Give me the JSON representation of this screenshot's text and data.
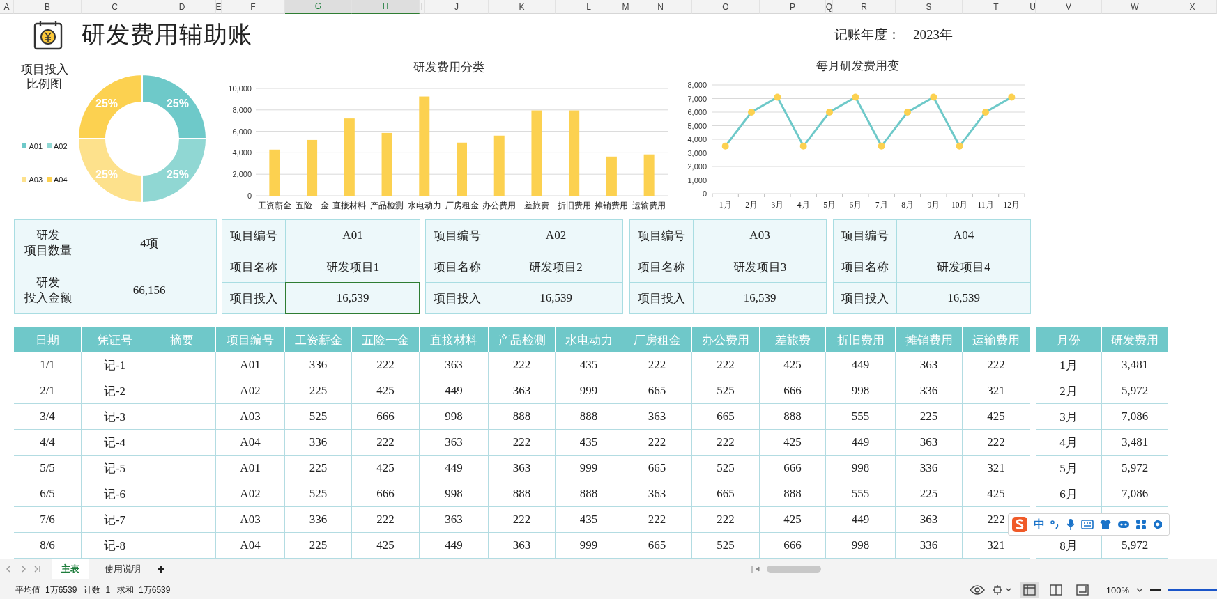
{
  "columns": [
    {
      "label": "A",
      "selected": false
    },
    {
      "label": "B",
      "selected": false
    },
    {
      "label": "C",
      "selected": false
    },
    {
      "label": "D",
      "selected": false
    },
    {
      "label": "E",
      "selected": false
    },
    {
      "label": "F",
      "selected": false
    },
    {
      "label": "G",
      "selected": true
    },
    {
      "label": "H",
      "selected": true
    },
    {
      "label": "I",
      "selected": false
    },
    {
      "label": "J",
      "selected": false
    },
    {
      "label": "K",
      "selected": false
    },
    {
      "label": "L",
      "selected": false
    },
    {
      "label": "M",
      "selected": false
    },
    {
      "label": "N",
      "selected": false
    },
    {
      "label": "O",
      "selected": false
    },
    {
      "label": "P",
      "selected": false
    },
    {
      "label": "Q",
      "selected": false
    },
    {
      "label": "R",
      "selected": false
    },
    {
      "label": "S",
      "selected": false
    },
    {
      "label": "T",
      "selected": false
    },
    {
      "label": "U",
      "selected": false
    },
    {
      "label": "V",
      "selected": false
    },
    {
      "label": "W",
      "selected": false
    },
    {
      "label": "X",
      "selected": false
    }
  ],
  "title": "研发费用辅助账",
  "year": {
    "label": "记账年度：",
    "value": "2023年"
  },
  "pie_chart": {
    "chart_data": {
      "type": "donut",
      "title": "项目投入比例图",
      "categories": [
        "A01",
        "A02",
        "A03",
        "A04"
      ],
      "values": [
        25,
        25,
        25,
        25
      ],
      "colors": [
        "#6ec9c9",
        "#90d7d3",
        "#fde18c",
        "#fcd150"
      ],
      "value_labels": [
        "25%",
        "25%",
        "25%",
        "25%"
      ],
      "legend": "left"
    }
  },
  "category_chart": {
    "chart_data": {
      "type": "bar",
      "title": "研发费用分类",
      "categories": [
        "工资薪金",
        "五险一金",
        "直接材料",
        "产品检测",
        "水电动力",
        "厂房租金",
        "办公费用",
        "差旅费",
        "折旧费用",
        "摊销费用",
        "运输费用"
      ],
      "series": [
        {
          "color": "#fcd150",
          "values": [
            4300,
            5200,
            7200,
            5850,
            9250,
            4950,
            5600,
            7950,
            7950,
            3650,
            3850
          ]
        }
      ],
      "grid": true,
      "ylim": [
        0,
        10000
      ],
      "yticks": [
        {
          "value": 0,
          "label": "0"
        },
        {
          "value": 2000,
          "label": "2,000"
        },
        {
          "value": 4000,
          "label": "4,000"
        },
        {
          "value": 6000,
          "label": "6,000"
        },
        {
          "value": 8000,
          "label": "8,000"
        },
        {
          "value": 10000,
          "label": "10,000"
        }
      ]
    }
  },
  "monthly_chart": {
    "chart_data": {
      "type": "line",
      "title": "每月研发费用变",
      "categories": [
        "1月",
        "2月",
        "3月",
        "4月",
        "5月",
        "6月",
        "7月",
        "8月",
        "9月",
        "10月",
        "11月",
        "12月"
      ],
      "series": [
        {
          "color": "#6ec9c9",
          "marker": {
            "shape": "circle",
            "color": "#fcd150"
          },
          "values": [
            3500,
            6000,
            7100,
            3500,
            6000,
            7100,
            3500,
            6000,
            7100,
            3500,
            6000,
            7100
          ]
        }
      ],
      "grid": true,
      "ylim": [
        0,
        8000
      ],
      "yticks": [
        {
          "value": 0,
          "label": "0"
        },
        {
          "value": 1000,
          "label": "1,000"
        },
        {
          "value": 2000,
          "label": "2,000"
        },
        {
          "value": 3000,
          "label": "3,000"
        },
        {
          "value": 4000,
          "label": "4,000"
        },
        {
          "value": 5000,
          "label": "5,000"
        },
        {
          "value": 6000,
          "label": "6,000"
        },
        {
          "value": 7000,
          "label": "7,000"
        },
        {
          "value": 8000,
          "label": "8,000"
        }
      ]
    }
  },
  "summary_card": [
    {
      "label_lines": [
        "研发",
        "项目数量"
      ],
      "value": "4项"
    },
    {
      "label_lines": [
        "研发",
        "投入金额"
      ],
      "value": "66,156"
    }
  ],
  "project_cards": [
    {
      "fields": [
        {
          "label": "项目编号",
          "value": "A01",
          "selected": false
        },
        {
          "label": "项目名称",
          "value": "研发项目1",
          "selected": false
        },
        {
          "label": "项目投入",
          "value": "16,539",
          "selected": true
        }
      ]
    },
    {
      "fields": [
        {
          "label": "项目编号",
          "value": "A02",
          "selected": false
        },
        {
          "label": "项目名称",
          "value": "研发项目2",
          "selected": false
        },
        {
          "label": "项目投入",
          "value": "16,539",
          "selected": false
        }
      ]
    },
    {
      "fields": [
        {
          "label": "项目编号",
          "value": "A03",
          "selected": false
        },
        {
          "label": "项目名称",
          "value": "研发项目3",
          "selected": false
        },
        {
          "label": "项目投入",
          "value": "16,539",
          "selected": false
        }
      ]
    },
    {
      "fields": [
        {
          "label": "项目编号",
          "value": "A04",
          "selected": false
        },
        {
          "label": "项目名称",
          "value": "研发项目4",
          "selected": false
        },
        {
          "label": "项目投入",
          "value": "16,539",
          "selected": false
        }
      ]
    }
  ],
  "ledger": {
    "columns": [
      "日期",
      "凭证号",
      "摘要",
      "项目编号",
      "工资薪金",
      "五险一金",
      "直接材料",
      "产品检测",
      "水电动力",
      "厂房租金",
      "办公费用",
      "差旅费",
      "折旧费用",
      "摊销费用",
      "运输费用"
    ],
    "rows": [
      [
        "1/1",
        "记-1",
        "",
        "A01",
        "336",
        "222",
        "363",
        "222",
        "435",
        "222",
        "222",
        "425",
        "449",
        "363",
        "222"
      ],
      [
        "2/1",
        "记-2",
        "",
        "A02",
        "225",
        "425",
        "449",
        "363",
        "999",
        "665",
        "525",
        "666",
        "998",
        "336",
        "321"
      ],
      [
        "3/4",
        "记-3",
        "",
        "A03",
        "525",
        "666",
        "998",
        "888",
        "888",
        "363",
        "665",
        "888",
        "555",
        "225",
        "425"
      ],
      [
        "4/4",
        "记-4",
        "",
        "A04",
        "336",
        "222",
        "363",
        "222",
        "435",
        "222",
        "222",
        "425",
        "449",
        "363",
        "222"
      ],
      [
        "5/5",
        "记-5",
        "",
        "A01",
        "225",
        "425",
        "449",
        "363",
        "999",
        "665",
        "525",
        "666",
        "998",
        "336",
        "321"
      ],
      [
        "6/5",
        "记-6",
        "",
        "A02",
        "525",
        "666",
        "998",
        "888",
        "888",
        "363",
        "665",
        "888",
        "555",
        "225",
        "425"
      ],
      [
        "7/6",
        "记-7",
        "",
        "A03",
        "336",
        "222",
        "363",
        "222",
        "435",
        "222",
        "222",
        "425",
        "449",
        "363",
        "222"
      ],
      [
        "8/6",
        "记-8",
        "",
        "A04",
        "225",
        "425",
        "449",
        "363",
        "999",
        "665",
        "525",
        "666",
        "998",
        "336",
        "321"
      ]
    ]
  },
  "monthly": {
    "columns": [
      "月份",
      "研发费用"
    ],
    "rows": [
      {
        "month": "1月",
        "amount": "3,481"
      },
      {
        "month": "2月",
        "amount": "5,972"
      },
      {
        "month": "3月",
        "amount": "7,086"
      },
      {
        "month": "4月",
        "amount": "3,481"
      },
      {
        "month": "5月",
        "amount": "5,972"
      },
      {
        "month": "6月",
        "amount": "7,086"
      },
      {},
      {
        "month": "8月",
        "amount": "5,972"
      }
    ]
  },
  "ime_toolbar": {
    "label": "中"
  },
  "sheet_tabs": [
    {
      "label": "主表",
      "selected": true
    },
    {
      "label": "使用说明",
      "selected": false
    }
  ],
  "status_bar": {
    "stats": [
      "平均值=1万6539",
      "计数=1",
      "求和=1万6539"
    ],
    "views": [
      {
        "kind": "normal",
        "selected": true
      },
      {
        "kind": "page_break",
        "selected": false
      },
      {
        "kind": "reading",
        "selected": false
      }
    ],
    "zoom": "100%",
    "zoom_slider": {
      "level": 1
    }
  }
}
